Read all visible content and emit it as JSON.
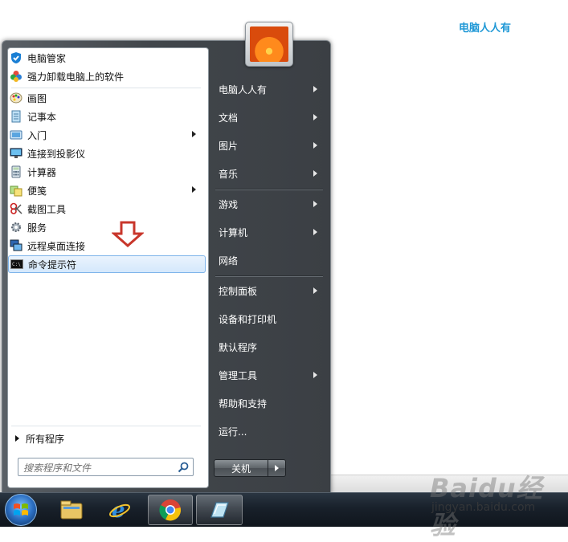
{
  "desktop": {
    "top_label": "电脑人人有",
    "watermark_logo": "Baidu经验",
    "watermark_url": "jingyan.baidu.com"
  },
  "start_menu": {
    "left": {
      "pinned": [
        {
          "label": "电脑管家",
          "icon": "shield-icon",
          "submenu": false
        },
        {
          "label": "强力卸载电脑上的软件",
          "icon": "clover-icon",
          "submenu": false
        }
      ],
      "recent": [
        {
          "label": "画图",
          "icon": "paint-icon",
          "submenu": false
        },
        {
          "label": "记事本",
          "icon": "notepad-icon",
          "submenu": false
        },
        {
          "label": "入门",
          "icon": "getting-started-icon",
          "submenu": true
        },
        {
          "label": "连接到投影仪",
          "icon": "projector-icon",
          "submenu": false
        },
        {
          "label": "计算器",
          "icon": "calculator-icon",
          "submenu": false
        },
        {
          "label": "便笺",
          "icon": "sticky-notes-icon",
          "submenu": true
        },
        {
          "label": "截图工具",
          "icon": "snipping-tool-icon",
          "submenu": false
        },
        {
          "label": "服务",
          "icon": "services-gear-icon",
          "submenu": false
        },
        {
          "label": "远程桌面连接",
          "icon": "remote-desktop-icon",
          "submenu": false
        },
        {
          "label": "命令提示符",
          "icon": "cmd-icon",
          "submenu": false,
          "selected": true
        }
      ],
      "all_programs": "所有程序",
      "search_placeholder": "搜索程序和文件"
    },
    "right": {
      "items": [
        {
          "label": "电脑人人有",
          "submenu": true
        },
        {
          "label": "文档",
          "submenu": true
        },
        {
          "label": "图片",
          "submenu": true
        },
        {
          "label": "音乐",
          "submenu": true
        },
        {
          "label": "游戏",
          "submenu": true
        },
        {
          "label": "计算机",
          "submenu": true
        },
        {
          "label": "网络",
          "submenu": false
        },
        {
          "label": "控制面板",
          "submenu": true
        },
        {
          "label": "设备和打印机",
          "submenu": false
        },
        {
          "label": "默认程序",
          "submenu": false
        },
        {
          "label": "管理工具",
          "submenu": true
        },
        {
          "label": "帮助和支持",
          "submenu": false
        },
        {
          "label": "运行...",
          "submenu": false
        }
      ],
      "shutdown_label": "关机"
    }
  },
  "taskbar": {
    "items": [
      {
        "icon": "windows-start-orb-icon"
      },
      {
        "icon": "file-explorer-icon"
      },
      {
        "icon": "internet-explorer-icon"
      },
      {
        "icon": "chrome-browser-icon",
        "active": true
      },
      {
        "icon": "app-window-icon",
        "active": true
      }
    ]
  },
  "colors": {
    "accent_blue": "#1f98d6",
    "arrow_red": "#c8362b",
    "selection_border": "#7eb4ea"
  }
}
